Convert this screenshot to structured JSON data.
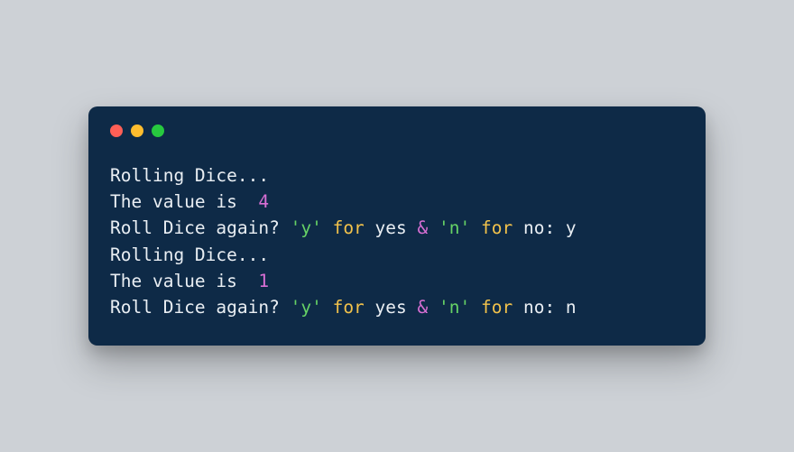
{
  "terminal": {
    "lines": [
      {
        "parts": [
          {
            "cls": "txt",
            "text": "Rolling Dice..."
          }
        ]
      },
      {
        "parts": [
          {
            "cls": "txt",
            "text": "The value is  "
          },
          {
            "cls": "num",
            "text": "4"
          }
        ]
      },
      {
        "parts": [
          {
            "cls": "txt",
            "text": "Roll Dice again? "
          },
          {
            "cls": "str",
            "text": "'y'"
          },
          {
            "cls": "txt",
            "text": " "
          },
          {
            "cls": "kw",
            "text": "for"
          },
          {
            "cls": "txt",
            "text": " yes "
          },
          {
            "cls": "op",
            "text": "&"
          },
          {
            "cls": "txt",
            "text": " "
          },
          {
            "cls": "str",
            "text": "'n'"
          },
          {
            "cls": "txt",
            "text": " "
          },
          {
            "cls": "kw",
            "text": "for"
          },
          {
            "cls": "txt",
            "text": " no: y"
          }
        ]
      },
      {
        "parts": [
          {
            "cls": "txt",
            "text": "Rolling Dice..."
          }
        ]
      },
      {
        "parts": [
          {
            "cls": "txt",
            "text": "The value is  "
          },
          {
            "cls": "num",
            "text": "1"
          }
        ]
      },
      {
        "parts": [
          {
            "cls": "txt",
            "text": "Roll Dice again? "
          },
          {
            "cls": "str",
            "text": "'y'"
          },
          {
            "cls": "txt",
            "text": " "
          },
          {
            "cls": "kw",
            "text": "for"
          },
          {
            "cls": "txt",
            "text": " yes "
          },
          {
            "cls": "op",
            "text": "&"
          },
          {
            "cls": "txt",
            "text": " "
          },
          {
            "cls": "str",
            "text": "'n'"
          },
          {
            "cls": "txt",
            "text": " "
          },
          {
            "cls": "kw",
            "text": "for"
          },
          {
            "cls": "txt",
            "text": " no: n"
          }
        ]
      }
    ]
  }
}
